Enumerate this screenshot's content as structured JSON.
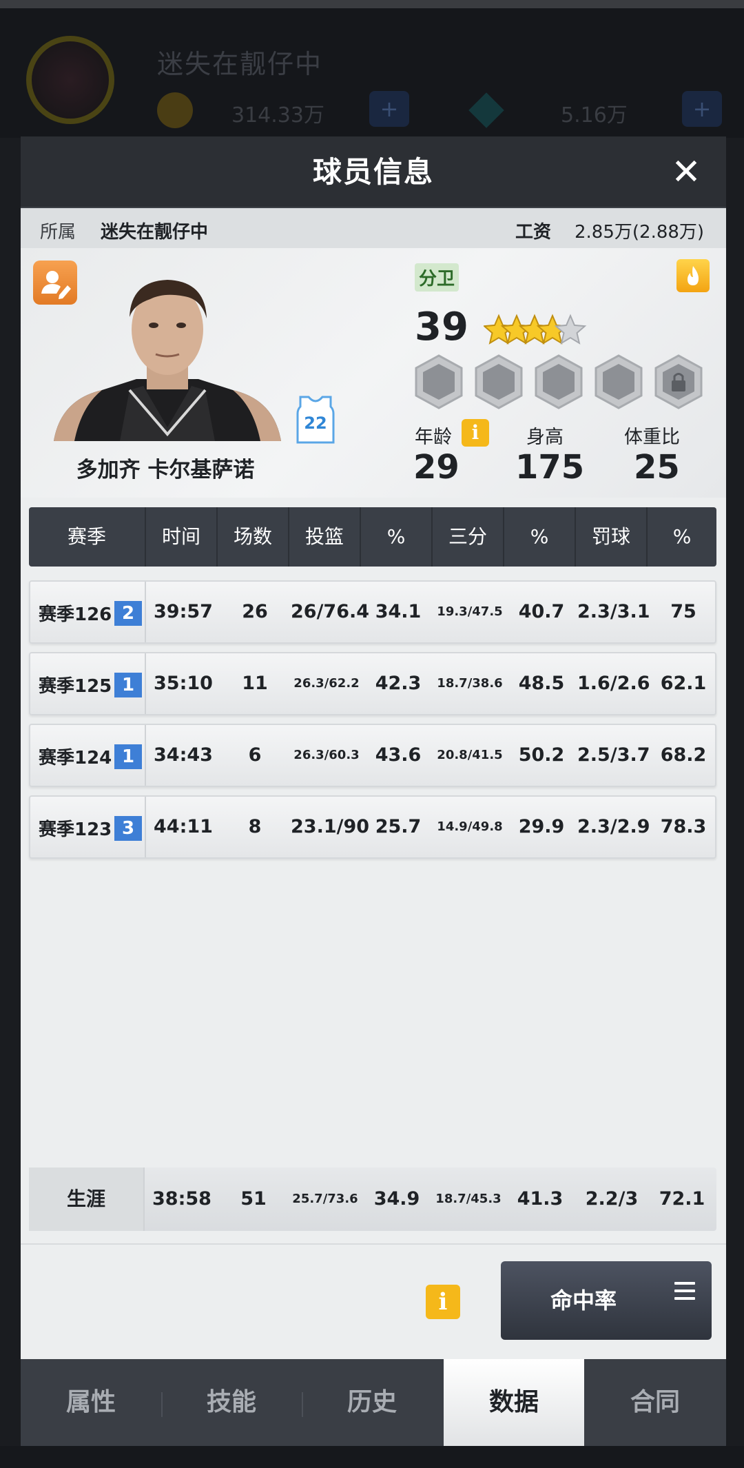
{
  "background": {
    "team_name": "迷失在靓仔中",
    "coins": "314.33万",
    "gems": "5.16万",
    "plus": "+"
  },
  "modal": {
    "title": "球员信息",
    "close": "✕"
  },
  "info_bar": {
    "team_label": "所属",
    "team_value": "迷失在靓仔中",
    "salary_label": "工资",
    "salary_value": "2.85万(2.88万)"
  },
  "player": {
    "name": "多加齐 卡尔基萨诺",
    "position": "分卫",
    "rating": "39",
    "stars": 4,
    "jersey_number": "22",
    "age_label": "年龄",
    "age": "29",
    "height_label": "身高",
    "height": "175",
    "weight_label": "体重比",
    "weight": "25",
    "info_icon": "i"
  },
  "icons": {
    "edit": "edit-profile-icon",
    "fire": "fire-icon",
    "lock": "lock-icon",
    "info": "info-icon",
    "menu": "menu-icon"
  },
  "table": {
    "headers": [
      "赛季",
      "时间",
      "场数",
      "投篮",
      "%",
      "三分",
      "%",
      "罚球",
      "%"
    ],
    "rows": [
      {
        "season": "赛季126",
        "tag": "2",
        "time": "39:57",
        "games": "26",
        "fg": "26/76.4",
        "fg_pct": "34.1",
        "three": "19.3/47.5",
        "three_pct": "40.7",
        "ft": "2.3/3.1",
        "ft_pct": "75"
      },
      {
        "season": "赛季125",
        "tag": "1",
        "time": "35:10",
        "games": "11",
        "fg": "26.3/62.2",
        "fg_pct": "42.3",
        "three": "18.7/38.6",
        "three_pct": "48.5",
        "ft": "1.6/2.6",
        "ft_pct": "62.1"
      },
      {
        "season": "赛季124",
        "tag": "1",
        "time": "34:43",
        "games": "6",
        "fg": "26.3/60.3",
        "fg_pct": "43.6",
        "three": "20.8/41.5",
        "three_pct": "50.2",
        "ft": "2.5/3.7",
        "ft_pct": "68.2"
      },
      {
        "season": "赛季123",
        "tag": "3",
        "time": "44:11",
        "games": "8",
        "fg": "23.1/90",
        "fg_pct": "25.7",
        "three": "14.9/49.8",
        "three_pct": "29.9",
        "ft": "2.3/2.9",
        "ft_pct": "78.3"
      }
    ],
    "career": {
      "label": "生涯",
      "time": "38:58",
      "games": "51",
      "fg": "25.7/73.6",
      "fg_pct": "34.9",
      "three": "18.7/45.3",
      "three_pct": "41.3",
      "ft": "2.2/3",
      "ft_pct": "72.1"
    }
  },
  "footer": {
    "info_icon": "i",
    "accuracy_button": "命中率"
  },
  "tabs": [
    "属性",
    "技能",
    "历史",
    "数据",
    "合同"
  ],
  "active_tab": "数据",
  "colors": {
    "header_bg": "#2c2f34",
    "season_tag": "#3e7fd6",
    "info_icon": "#f5b81a",
    "edit_button": "#e27a25",
    "position_badge": "#d3e8cd"
  }
}
